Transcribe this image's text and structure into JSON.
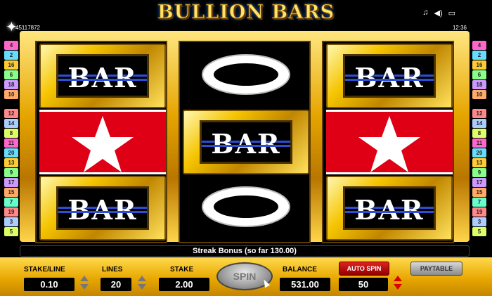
{
  "header": {
    "title": "BULLION BARS",
    "session_id": "45117872",
    "clock": "12:36",
    "icons": [
      "music-note-icon",
      "speaker-icon",
      "fullscreen-icon"
    ]
  },
  "left_numbers": [
    "4",
    "2",
    "16",
    "6",
    "18",
    "10",
    "",
    "12",
    "14",
    "8",
    "11",
    "20",
    "13",
    "9",
    "17",
    "15",
    "7",
    "19",
    "3",
    "5"
  ],
  "right_numbers": [
    "4",
    "2",
    "16",
    "6",
    "18",
    "10",
    "",
    "12",
    "14",
    "8",
    "11",
    "20",
    "13",
    "9",
    "17",
    "15",
    "7",
    "19",
    "3",
    "5"
  ],
  "reels": [
    {
      "symbols": [
        "BAR",
        "star",
        "BAR"
      ]
    },
    {
      "symbols": [
        "ring",
        "BAR",
        "ring"
      ]
    },
    {
      "symbols": [
        "BAR",
        "star",
        "BAR"
      ]
    }
  ],
  "bonus_text": "Streak Bonus (so far 130.00)",
  "controls": {
    "stake_line_label": "STAKE/LINE",
    "stake_line_value": "0.10",
    "lines_label": "LINES",
    "lines_value": "20",
    "stake_label": "STAKE",
    "stake_value": "2.00",
    "spin_label": "SPIN",
    "balance_label": "BALANCE",
    "balance_value": "531.00",
    "auto_spin_label": "AUTO SPIN",
    "auto_spin_value": "50",
    "paytable_label": "PAYTABLE"
  },
  "colors": {
    "gold": "#e6a500",
    "star_red": "#e00016",
    "bar_blue_line": "#2b4fd8"
  }
}
